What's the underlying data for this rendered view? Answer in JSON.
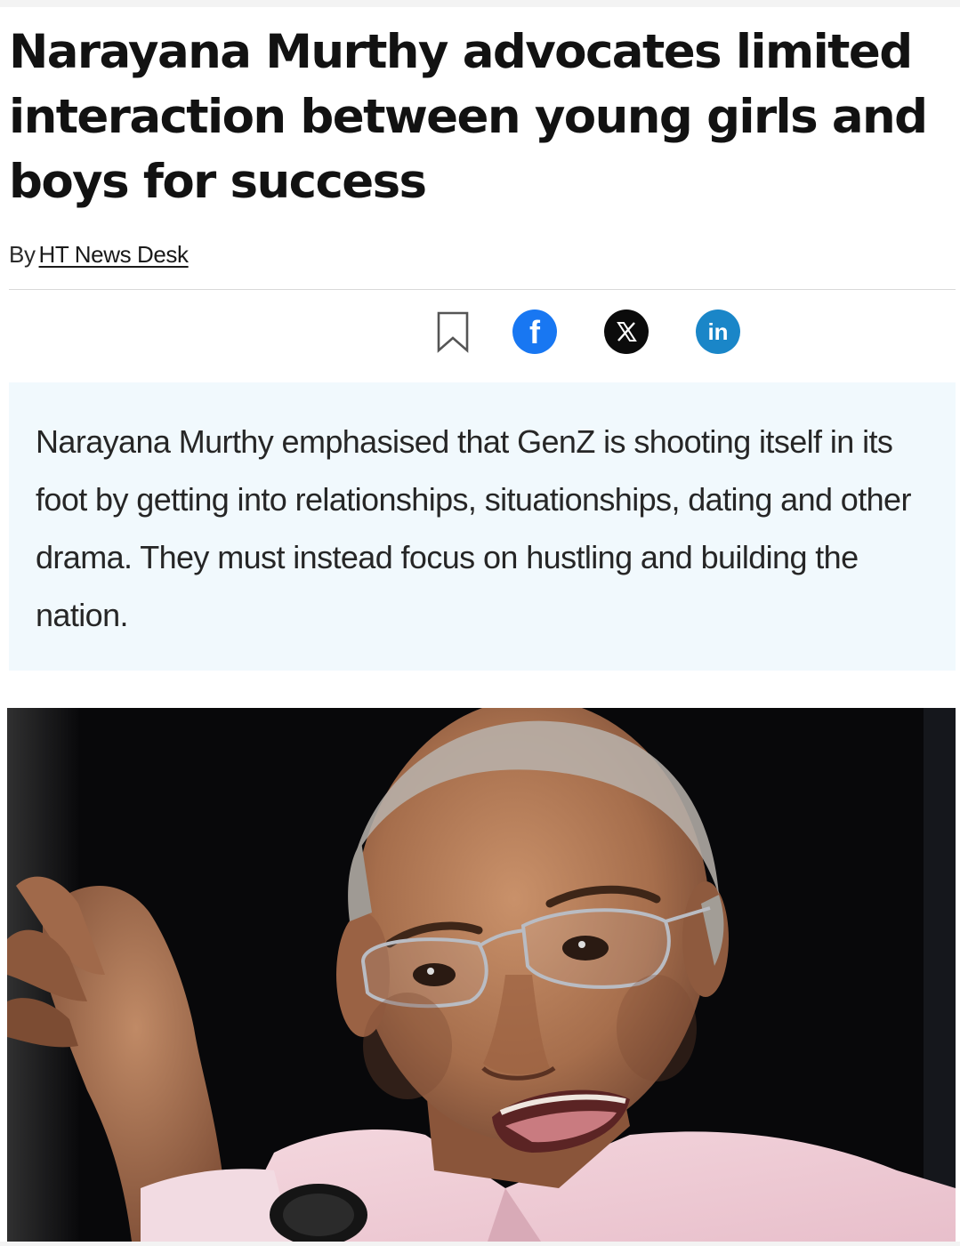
{
  "article": {
    "headline": "Narayana Murthy advocates limited interaction between young girls and boys for success",
    "byline_prefix": "By",
    "author": "HT News Desk",
    "summary": "Narayana Murthy emphasised that GenZ is shooting itself in its foot by getting into relationships, situationships, dating and other drama. They must instead focus on hustling and building the nation."
  },
  "share": {
    "icons": [
      "bookmark-icon",
      "facebook-icon",
      "x-icon",
      "linkedin-icon"
    ],
    "facebook_glyph": "f",
    "linkedin_glyph": "in"
  },
  "colors": {
    "summary_background": "#f1f9fd",
    "facebook": "#1877f2",
    "x": "#0b0b0b",
    "linkedin": "#1a86c8"
  }
}
